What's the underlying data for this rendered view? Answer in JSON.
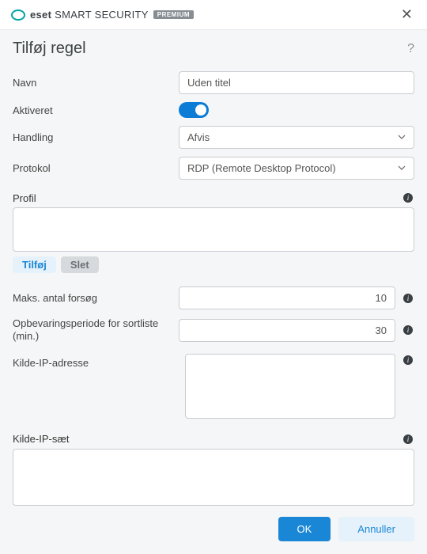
{
  "brand": {
    "eset": "eset",
    "name": "SMART SECURITY",
    "badge": "PREMIUM"
  },
  "dialog": {
    "title": "Tilføj regel"
  },
  "fields": {
    "name_label": "Navn",
    "name_value": "Uden titel",
    "enabled_label": "Aktiveret",
    "enabled_value": true,
    "action_label": "Handling",
    "action_value": "Afvis",
    "protocol_label": "Protokol",
    "protocol_value": "RDP (Remote Desktop Protocol)",
    "profile_label": "Profil",
    "max_attempts_label": "Maks. antal forsøg",
    "max_attempts_value": "10",
    "retention_label": "Opbevaringsperiode for sortliste (min.)",
    "retention_value": "30",
    "src_ip_label": "Kilde-IP-adresse",
    "src_ip_set_label": "Kilde-IP-sæt"
  },
  "buttons": {
    "add": "Tilføj",
    "delete": "Slet",
    "ok": "OK",
    "cancel": "Annuller"
  }
}
